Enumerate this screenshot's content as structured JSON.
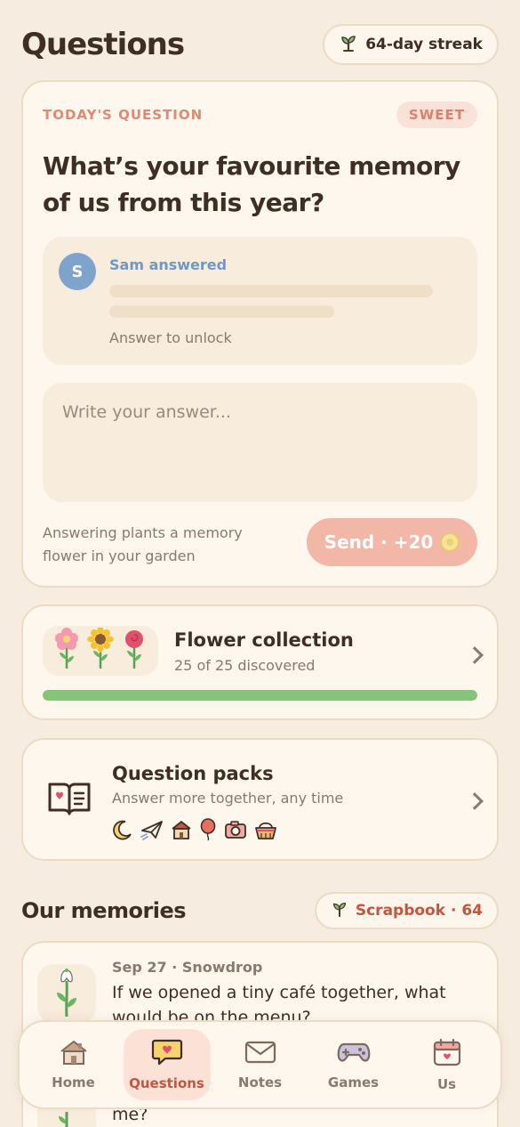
{
  "header": {
    "title": "Questions",
    "streak": "64-day streak",
    "streak_icon": "sprout-icon"
  },
  "question_card": {
    "label": "TODAY'S QUESTION",
    "tag": "SWEET",
    "question": "What’s your favourite memory of us from this year?",
    "partner": {
      "initial": "S",
      "name": "Sam answered",
      "locked_text": "Answer to unlock"
    },
    "input_placeholder": "Write your answer...",
    "footnote": "Answering plants a memory flower in your garden",
    "send_label": "Send · +20",
    "colors": {
      "accent": "#e08a72",
      "send_bg": "#f2b7a7",
      "partner": "#7ea3cc"
    }
  },
  "flower_collection": {
    "title": "Flower collection",
    "subtitle": "25 of 25 discovered",
    "progress": 1.0,
    "progress_color": "#86c47a",
    "flowers": [
      "pink-flower-icon",
      "sunflower-icon",
      "rose-icon"
    ]
  },
  "question_packs": {
    "title": "Question packs",
    "subtitle": "Answer more together, any time",
    "icons": [
      "moon-icon",
      "paper-plane-icon",
      "house-icon",
      "balloon-icon",
      "camera-icon",
      "picnic-basket-icon"
    ]
  },
  "memories": {
    "title": "Our memories",
    "scrapbook": "Scrapbook · 64",
    "items": [
      {
        "meta": "Sep 27 · Snowdrop",
        "question": "If we opened a tiny café together, what would be on the menu?",
        "icon": "snowdrop-icon"
      },
      {
        "meta": "",
        "question": "me?",
        "icon": "sprout-icon"
      }
    ]
  },
  "tabs": [
    {
      "label": "Home",
      "icon": "house-icon",
      "active": false
    },
    {
      "label": "Questions",
      "icon": "heart-chat-icon",
      "active": true
    },
    {
      "label": "Notes",
      "icon": "envelope-icon",
      "active": false
    },
    {
      "label": "Games",
      "icon": "gamepad-icon",
      "active": false
    },
    {
      "label": "Us",
      "icon": "calendar-heart-icon",
      "active": false
    }
  ]
}
